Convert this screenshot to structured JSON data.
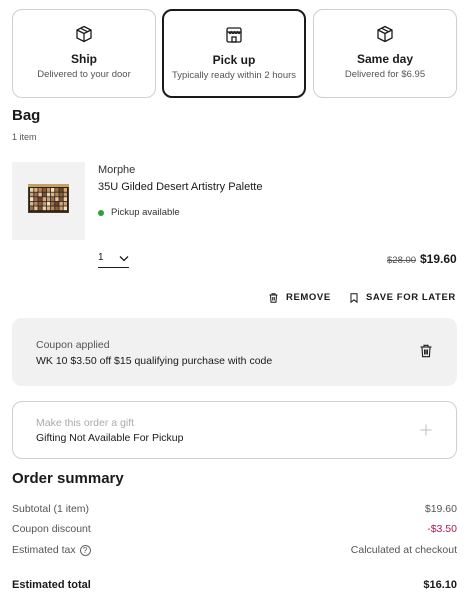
{
  "shipping_options": [
    {
      "icon": "box-icon",
      "title": "Ship",
      "subtitle": "Delivered to your door",
      "selected": false
    },
    {
      "icon": "store-icon",
      "title": "Pick up",
      "subtitle": "Typically ready within 2 hours",
      "selected": true
    },
    {
      "icon": "box-icon",
      "title": "Same day",
      "subtitle": "Delivered for $6.95",
      "selected": false
    }
  ],
  "bag": {
    "title": "Bag",
    "count": "1 item"
  },
  "product": {
    "brand": "Morphe",
    "name": "35U Gilded Desert Artistry Palette",
    "status": "Pickup available",
    "quantity": "1",
    "original_price": "$28.00",
    "price": "$19.60",
    "remove_label": "REMOVE",
    "save_label": "SAVE FOR LATER"
  },
  "coupon": {
    "label": "Coupon applied",
    "description": "WK 10 $3.50 off $15 qualifying purchase with code"
  },
  "gift": {
    "label": "Make this order a gift",
    "description": "Gifting Not Available For Pickup"
  },
  "summary": {
    "title": "Order summary",
    "subtotal_label": "Subtotal (1 item)",
    "subtotal_value": "$19.60",
    "coupon_label": "Coupon discount",
    "coupon_value": "-$3.50",
    "tax_label": "Estimated tax",
    "tax_value": "Calculated at checkout",
    "total_label": "Estimated total",
    "total_value": "$16.10"
  },
  "colors": {
    "discount": "#b0185c",
    "in_stock_dot": "#2e9e3a",
    "selected_border": "#1a1a1a"
  }
}
